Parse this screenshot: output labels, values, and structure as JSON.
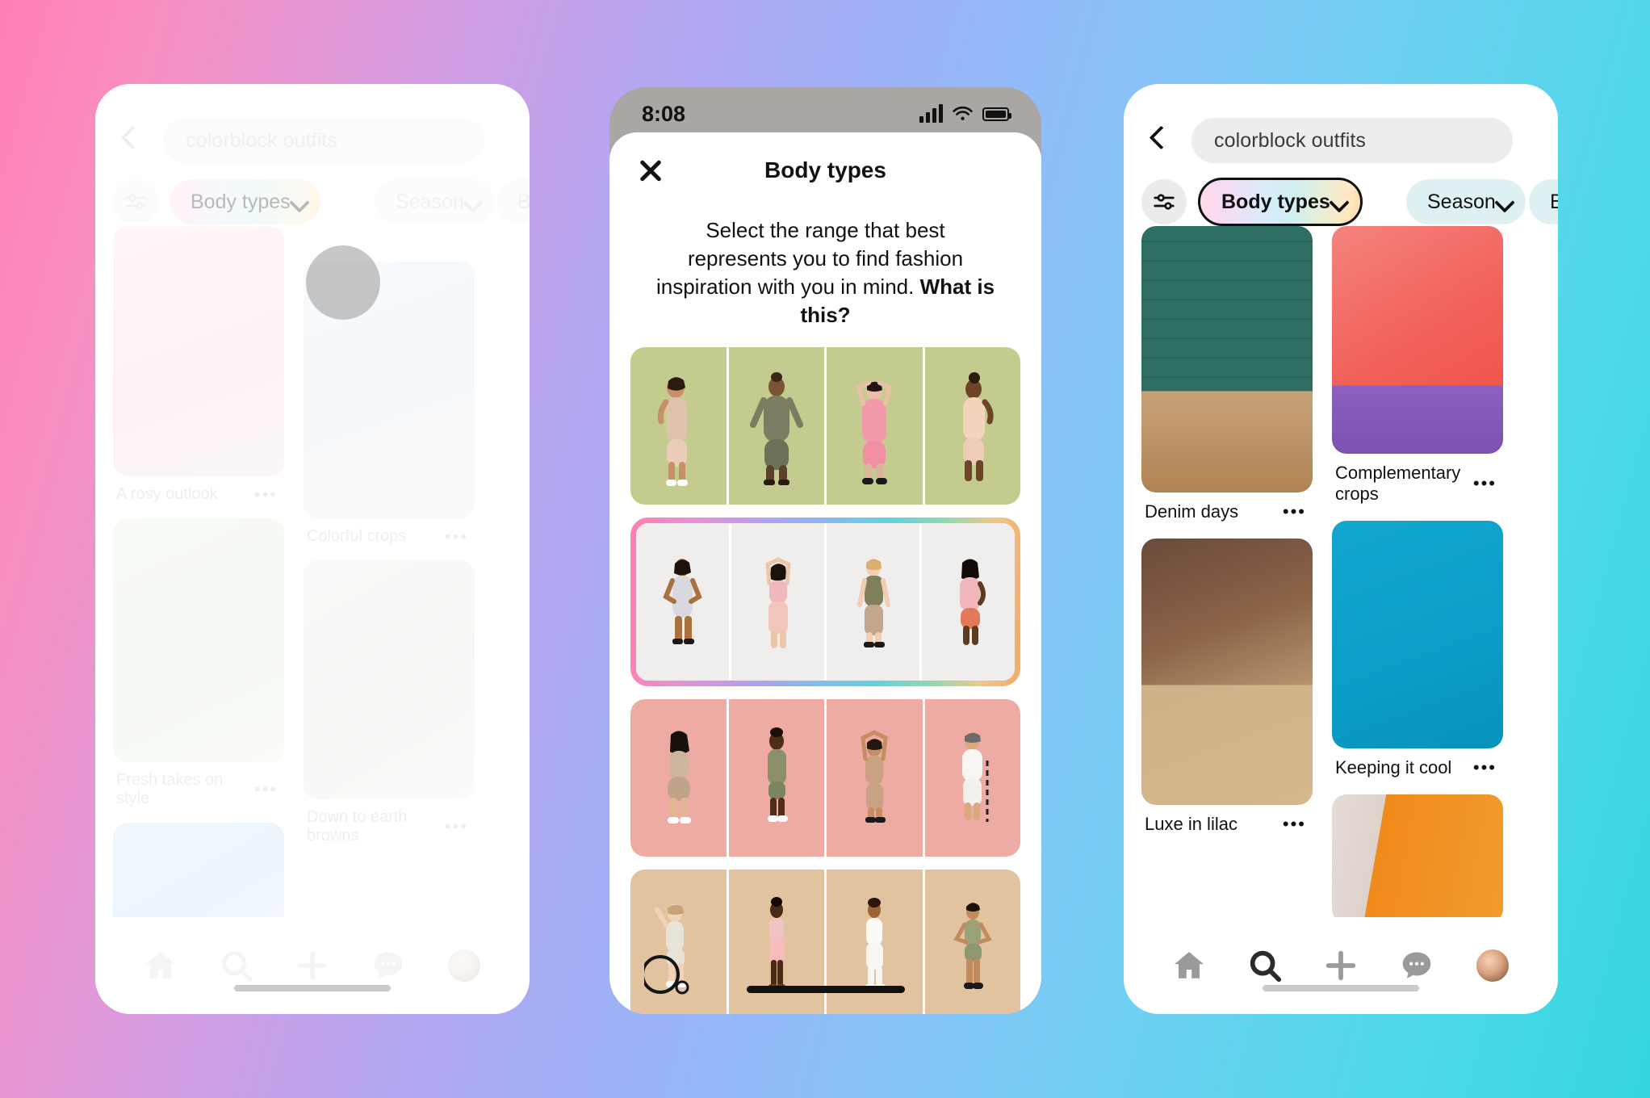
{
  "background": {
    "gradient_colors": [
      "#ff7eb3",
      "#b6a6f0",
      "#8cc0f8",
      "#35d6e0"
    ]
  },
  "phone_left": {
    "name": "search-results-dimmed",
    "search": {
      "value": "colorblock outfits",
      "placeholder": "Search"
    },
    "back_label": "Back",
    "filters": {
      "filter_icon": "sliders-icon",
      "chips": [
        {
          "label": "Body types",
          "has_chevron": true,
          "active": true,
          "style": "gradient"
        },
        {
          "label": "Season",
          "has_chevron": true,
          "active": false,
          "style": "plain"
        },
        {
          "label": "Best",
          "has_chevron": false,
          "active": false,
          "style": "plain"
        }
      ]
    },
    "pins": [
      {
        "title": "A rosy outlook",
        "overflow": "•••",
        "column": 0
      },
      {
        "title": "Colorful crops",
        "overflow": "•••",
        "column": 1
      },
      {
        "title": "Fresh takes on style",
        "overflow": "•••",
        "column": 0
      },
      {
        "title": "Down to earth browns",
        "overflow": "•••",
        "column": 1
      }
    ],
    "nav": [
      {
        "icon": "home-icon",
        "label": "Home"
      },
      {
        "icon": "search-icon",
        "label": "Search"
      },
      {
        "icon": "plus-icon",
        "label": "Create"
      },
      {
        "icon": "chat-bubble-icon",
        "label": "Messages"
      },
      {
        "icon": "avatar-icon",
        "label": "Profile"
      }
    ]
  },
  "phone_center": {
    "name": "body-types-modal",
    "status_bar": {
      "time": "8:08",
      "icons": [
        "cellular-signal-icon",
        "wifi-icon",
        "battery-icon"
      ]
    },
    "modal": {
      "close_label": "Close",
      "title": "Body types",
      "description_plain": "Select the range that best represents you to find fashion inspiration with you in mind. ",
      "description_link": "What is this?",
      "rows": [
        {
          "index": 1,
          "selected": false,
          "background": "#c3cc8e",
          "figures": [
            {
              "pose": "hand-on-hip",
              "garment": "beige tube dress",
              "skin": "#c98f68"
            },
            {
              "pose": "arms-out",
              "garment": "olive long sleeve set",
              "skin": "#7a5437"
            },
            {
              "pose": "arms-up",
              "garment": "pink set",
              "skin": "#e8c0a4"
            },
            {
              "pose": "side-profile",
              "garment": "nude set",
              "skin": "#6d4426"
            }
          ]
        },
        {
          "index": 2,
          "selected": true,
          "background": "#f0eeed",
          "figures": [
            {
              "pose": "hands-on-hips",
              "garment": "grey tee dress",
              "skin": "#a9713f"
            },
            {
              "pose": "arms-up",
              "garment": "pink top and skirt",
              "skin": "#eac7ab"
            },
            {
              "pose": "standing",
              "garment": "olive tank and leggings",
              "skin": "#f0cdb3"
            },
            {
              "pose": "side-profile",
              "garment": "pink tee and coral shorts",
              "skin": "#5d3a22"
            }
          ]
        },
        {
          "index": 3,
          "selected": false,
          "background": "#eeaba4",
          "figures": [
            {
              "pose": "back-turned",
              "garment": "beige set",
              "skin": "#e3b693"
            },
            {
              "pose": "standing",
              "garment": "olive tee dress",
              "skin": "#4f2d18"
            },
            {
              "pose": "arms-up",
              "garment": "nude set",
              "skin": "#c68d62"
            },
            {
              "pose": "with-cane",
              "garment": "white dress",
              "skin": "#d9a87f"
            }
          ]
        },
        {
          "index": 4,
          "selected": false,
          "background": "#e2c3a0",
          "figures": [
            {
              "pose": "wheelchair",
              "garment": "cream set",
              "skin": "#f0d2b8"
            },
            {
              "pose": "standing",
              "garment": "pink tank and skirt",
              "skin": "#4a2a14"
            },
            {
              "pose": "side-profile",
              "garment": "white set",
              "skin": "#9c6536"
            },
            {
              "pose": "hands-on-hips",
              "garment": "sage romper",
              "skin": "#c08b5d"
            }
          ]
        }
      ]
    }
  },
  "phone_right": {
    "name": "search-results-filtered",
    "search": {
      "value": "colorblock outfits",
      "placeholder": "Search"
    },
    "back_label": "Back",
    "filters": {
      "filter_icon": "sliders-icon",
      "chips": [
        {
          "label": "Body types",
          "has_chevron": true,
          "active": true,
          "style": "gradient-outlined"
        },
        {
          "label": "Season",
          "has_chevron": true,
          "active": false,
          "style": "plain"
        },
        {
          "label": "Best",
          "has_chevron": false,
          "active": false,
          "style": "plain"
        }
      ]
    },
    "pins": [
      {
        "title": "Denim days",
        "overflow": "•••",
        "column": 0,
        "accent": "#2f6f63"
      },
      {
        "title": "Complementary crops",
        "overflow": "•••",
        "column": 1,
        "accent": "#f2605a"
      },
      {
        "title": "Luxe in lilac",
        "overflow": "•••",
        "column": 0,
        "accent": "#9b6fbf"
      },
      {
        "title": "Keeping it cool",
        "overflow": "•••",
        "column": 1,
        "accent": "#0a9ec9"
      },
      {
        "title": "",
        "overflow": "",
        "column": 1,
        "accent": "#f08a1a"
      }
    ],
    "nav": [
      {
        "icon": "home-icon",
        "label": "Home"
      },
      {
        "icon": "search-icon",
        "label": "Search"
      },
      {
        "icon": "plus-icon",
        "label": "Create"
      },
      {
        "icon": "chat-bubble-icon",
        "label": "Messages"
      },
      {
        "icon": "avatar-icon",
        "label": "Profile"
      }
    ]
  },
  "colors": {
    "chip_gradient_start": "#ffd9e8",
    "chip_gradient_end": "#ffdcb0",
    "selected_border_gradient": "#ff7fb0",
    "text_primary": "#111111",
    "pill_bg": "#ebebeb"
  }
}
